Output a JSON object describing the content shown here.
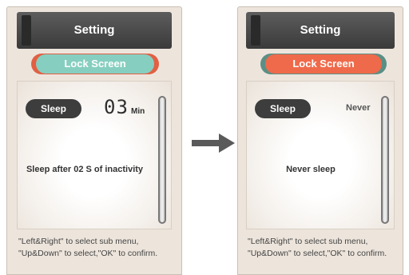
{
  "colors": {
    "teal": "#86cfc0",
    "teal_shadow": "#e25f43",
    "orange": "#ef6a4a",
    "orange_shadow": "#5b8f86",
    "arrow": "#5a5a5a"
  },
  "left": {
    "title": "Setting",
    "tab_label": "Lock Screen",
    "sleep_label": "Sleep",
    "time_value": "03",
    "time_unit": "Min",
    "message": "Sleep after 02 S of inactivity",
    "footer_line1": "\"Left&Right\" to select sub menu,",
    "footer_line2": "\"Up&Down\" to select,\"OK\" to confirm."
  },
  "right": {
    "title": "Setting",
    "tab_label": "Lock Screen",
    "sleep_label": "Sleep",
    "sleep_value": "Never",
    "message": "Never sleep",
    "footer_line1": "\"Left&Right\" to select sub menu,",
    "footer_line2": "\"Up&Down\" to select,\"OK\" to confirm."
  },
  "icons": {
    "arrow": "arrow-right-icon"
  }
}
